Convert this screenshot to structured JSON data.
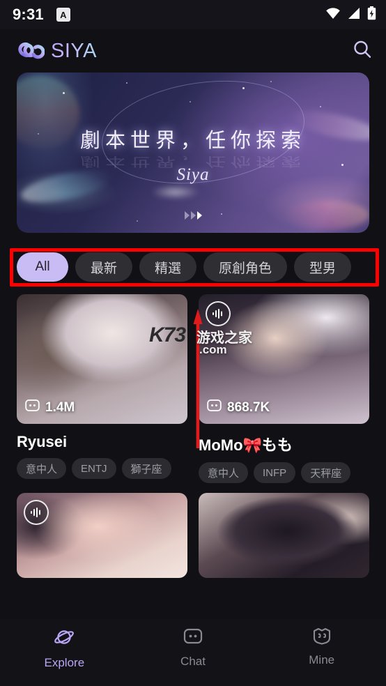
{
  "statusbar": {
    "time": "9:31",
    "notification_icon_letter": "A",
    "icons": [
      "wifi-icon",
      "cellular-signal-icon",
      "battery-charging-icon"
    ]
  },
  "appbar": {
    "brand_name": "SIYA",
    "logo_icon": "siya-infinity-logo",
    "search_icon": "search-icon"
  },
  "banner": {
    "title": "劇本世界，任你探索",
    "subtitle": "Siya",
    "page_indicator": {
      "total": 3,
      "active_index": 2
    }
  },
  "filters": {
    "chips": [
      {
        "label": "All",
        "active": true
      },
      {
        "label": "最新",
        "active": false
      },
      {
        "label": "精選",
        "active": false
      },
      {
        "label": "原創角色",
        "active": false
      },
      {
        "label": "型男",
        "active": false
      }
    ]
  },
  "cards": [
    {
      "name": "Ryusei",
      "chat_count": "1.4M",
      "chat_icon": "chat-bubble-icon",
      "has_voice_badge": false,
      "tags": [
        "意中人",
        "ENTJ",
        "獅子座"
      ]
    },
    {
      "name": "MoMo🎀もも",
      "chat_count": "868.7K",
      "chat_icon": "chat-bubble-icon",
      "has_voice_badge": true,
      "voice_icon": "voice-waveform-icon",
      "tags": [
        "意中人",
        "INFP",
        "天秤座"
      ]
    },
    {
      "name": "",
      "chat_count": "",
      "has_voice_badge": true,
      "voice_icon": "voice-waveform-icon",
      "tags": []
    },
    {
      "name": "",
      "chat_count": "",
      "has_voice_badge": false,
      "tags": []
    }
  ],
  "annotations": {
    "highlight_box_color": "#ff0000",
    "arrow_color": "#e01b1b",
    "arrow_icon": "red-up-arrow-annotation"
  },
  "watermark": {
    "logo": "K73",
    "chinese": "游戏之家",
    "domain": ".com"
  },
  "bottomnav": {
    "items": [
      {
        "label": "Explore",
        "icon": "planet-icon",
        "active": true
      },
      {
        "label": "Chat",
        "icon": "chat-bubble-icon",
        "active": false
      },
      {
        "label": "Mine",
        "icon": "mask-face-icon",
        "active": false
      }
    ]
  },
  "colors": {
    "background": "#111014",
    "accent": "#b9a6f5",
    "chip_active_bg": "#c9bcf5",
    "chip_bg": "#2e2e33",
    "annotation_red": "#ff0000"
  }
}
